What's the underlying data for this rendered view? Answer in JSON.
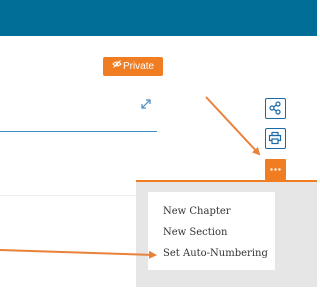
{
  "header": {
    "color": "#006e96"
  },
  "badge": {
    "label": "Private",
    "icon": "eye-slash-icon",
    "color": "#f07d22"
  },
  "toolbar": {
    "expand_icon": "expand-icon",
    "share_icon": "share-icon",
    "print_icon": "print-icon",
    "more_icon": "ellipsis-icon",
    "accent": "#1a6aa8"
  },
  "menu": {
    "items": [
      {
        "label": "New Chapter"
      },
      {
        "label": "New Section"
      },
      {
        "label": "Set Auto-Numbering"
      }
    ]
  },
  "annotations": {
    "arrow_color": "#e8823a"
  }
}
